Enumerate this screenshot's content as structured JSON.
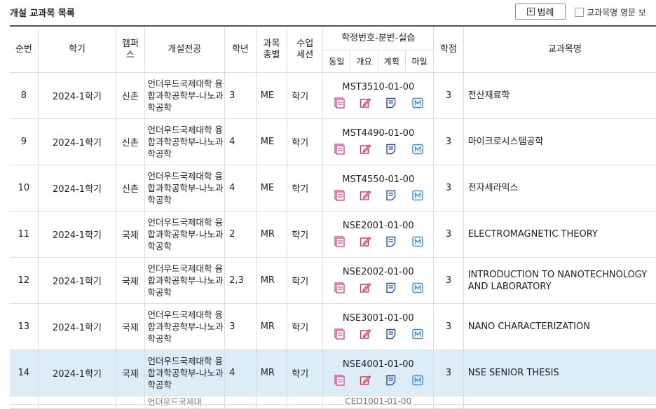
{
  "page": {
    "title": "개설 교과목 목록",
    "legend_label": "범례",
    "english_toggle_label": "교과목명 영문 보"
  },
  "table": {
    "headers": {
      "no": "순번",
      "semester": "학기",
      "campus": "캠퍼스",
      "dept": "개설전공",
      "year": "학년",
      "type": "과목종별",
      "session": "수업세션",
      "group": "학정번호-분반-실습",
      "sub": [
        "동일",
        "개요",
        "계획",
        "마일"
      ],
      "credit": "학점",
      "course_name": "교과목명"
    },
    "rows": [
      {
        "no": "8",
        "semester": "2024-1학기",
        "campus": "신촌",
        "dept": "언더우드국제대학 융합과학공학부-나노과학공학",
        "year": "3",
        "type": "ME",
        "session": "학기",
        "code": "MST3510-01-00",
        "credit": "3",
        "name": "전산재료학"
      },
      {
        "no": "9",
        "semester": "2024-1학기",
        "campus": "신촌",
        "dept": "언더우드국제대학 융합과학공학부-나노과학공학",
        "year": "4",
        "type": "ME",
        "session": "학기",
        "code": "MST4490-01-00",
        "credit": "3",
        "name": "마이크로시스템공학"
      },
      {
        "no": "10",
        "semester": "2024-1학기",
        "campus": "신촌",
        "dept": "언더우드국제대학 융합과학공학부-나노과학공학",
        "year": "4",
        "type": "ME",
        "session": "학기",
        "code": "MST4550-01-00",
        "credit": "3",
        "name": "전자세라믹스"
      },
      {
        "no": "11",
        "semester": "2024-1학기",
        "campus": "국제",
        "dept": "언더우드국제대학 융합과학공학부-나노과학공학",
        "year": "2",
        "type": "MR",
        "session": "학기",
        "code": "NSE2001-01-00",
        "credit": "3",
        "name": "ELECTROMAGNETIC THEORY"
      },
      {
        "no": "12",
        "semester": "2024-1학기",
        "campus": "국제",
        "dept": "언더우드국제대학 융합과학공학부-나노과학공학",
        "year": "2,3",
        "type": "MR",
        "session": "학기",
        "code": "NSE2002-01-00",
        "credit": "3",
        "name": "INTRODUCTION TO NANOTECHNOLOGY AND LABORATORY"
      },
      {
        "no": "13",
        "semester": "2024-1학기",
        "campus": "국제",
        "dept": "언더우드국제대학 융합과학공학부-나노과학공학",
        "year": "3",
        "type": "MR",
        "session": "학기",
        "code": "NSE3001-01-00",
        "credit": "3",
        "name": "NANO CHARACTERIZATION"
      },
      {
        "no": "14",
        "semester": "2024-1학기",
        "campus": "국제",
        "dept": "언더우드국제대학 융합과학공학부-나노과학공학",
        "year": "4",
        "type": "MR",
        "session": "학기",
        "code": "NSE4001-01-00",
        "credit": "3",
        "name": "NSE SENIOR THESIS",
        "selected": true
      }
    ],
    "partial_row": {
      "dept": "언더우드국제대",
      "code": "CED1001-01-00"
    },
    "icon_names": [
      "same-course-icon",
      "overview-icon",
      "syllabus-icon",
      "mileage-icon"
    ],
    "icon_colors": {
      "same": "#e24a8b",
      "overview": "#e0304a",
      "syllabus": "#2a4fa8",
      "mileage": "#3a8fd8"
    }
  }
}
